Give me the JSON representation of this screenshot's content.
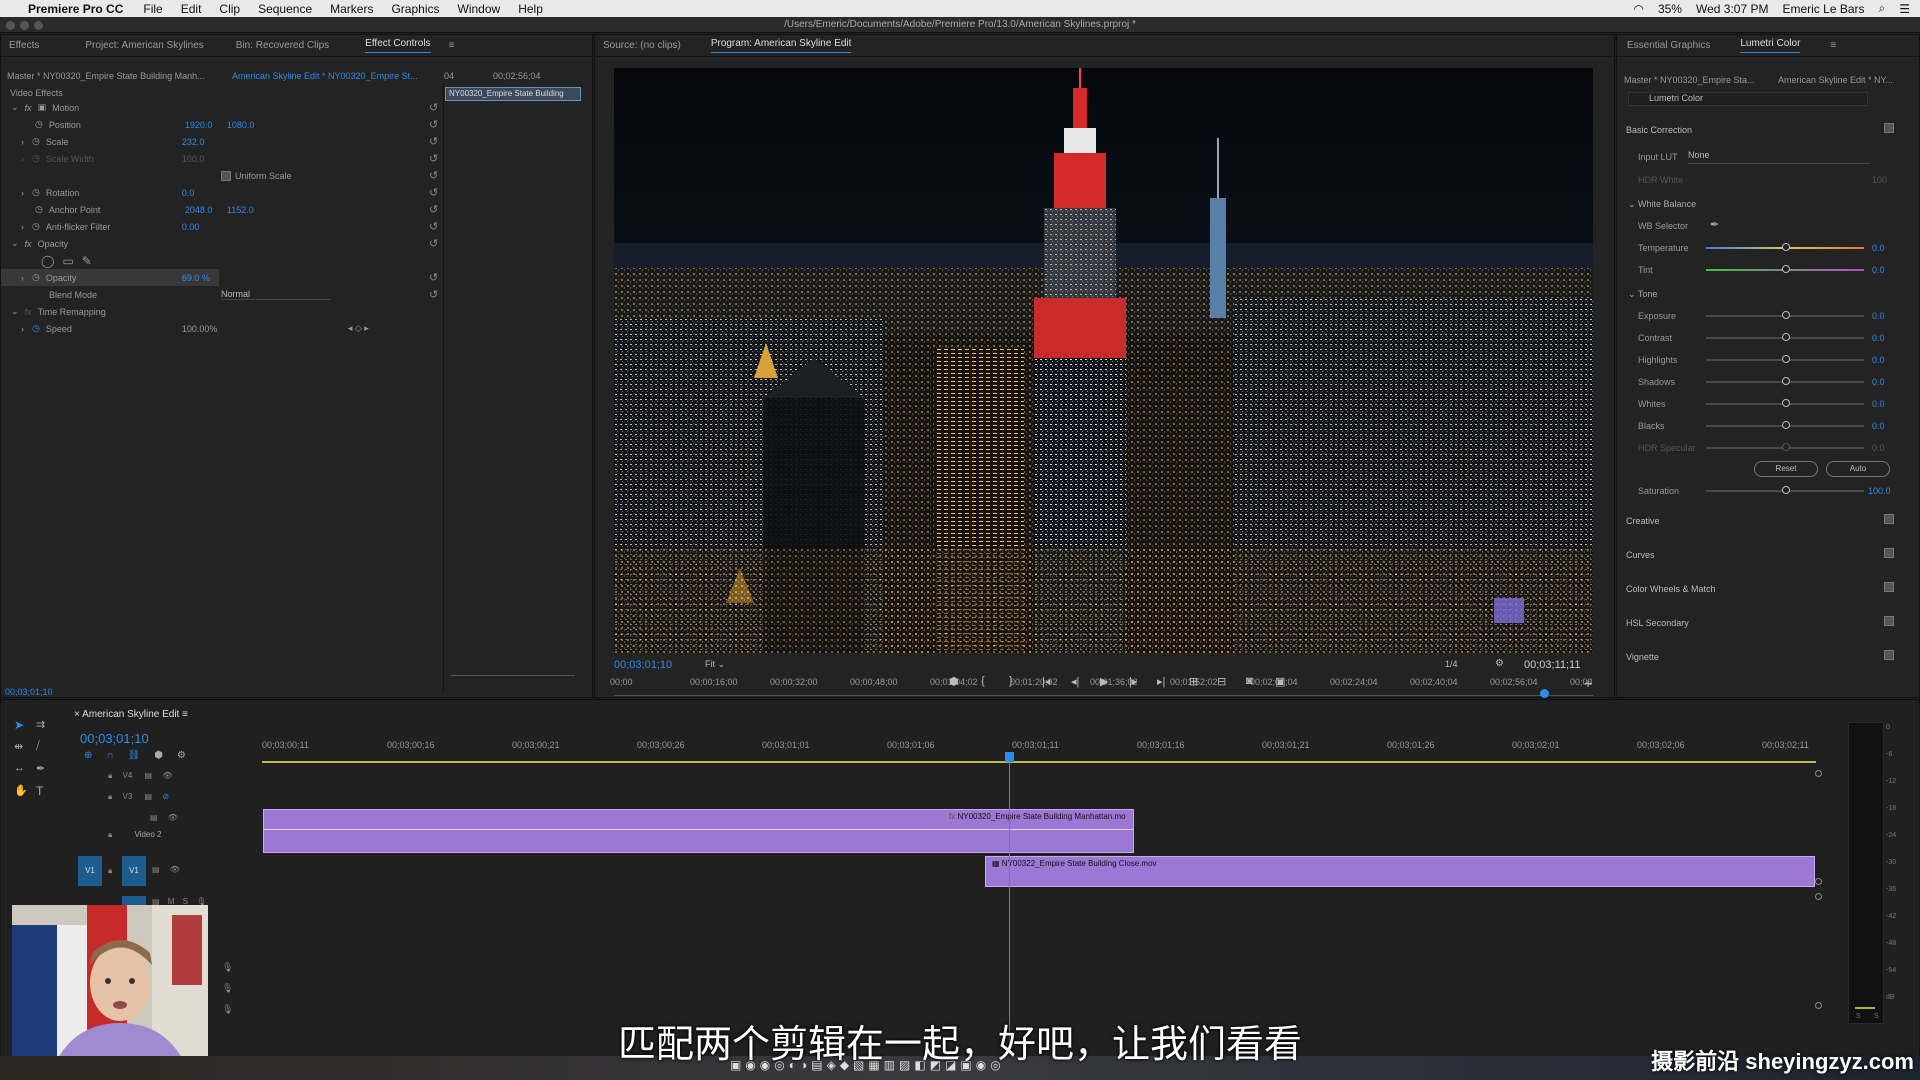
{
  "menubar": {
    "app_name": "Premiere Pro CC",
    "items": [
      "File",
      "Edit",
      "Clip",
      "Sequence",
      "Markers",
      "Graphics",
      "Window",
      "Help"
    ],
    "battery": "35%",
    "clock": "Wed 3:07 PM",
    "user": "Emeric Le Bars"
  },
  "titlebar": {
    "path": "/Users/Emeric/Documents/Adobe/Premiere Pro/13.0/American Skylines.prproj *"
  },
  "left_panel": {
    "tabs": [
      "Effects",
      "Project: American Skylines",
      "Bin: Recovered Clips",
      "Effect Controls"
    ],
    "master_label": "Master * NY00320_Empire State Building Manh...",
    "sequence_label": "American Skyline Edit * NY00320_Empire St...",
    "ruler_start": "04",
    "ruler_time": "00;02;56;04",
    "clip_bar_label": "NY00320_Empire State Building",
    "section_video_effects": "Video Effects",
    "motion": "Motion",
    "position_label": "Position",
    "position_x": "1920.0",
    "position_y": "1080.0",
    "scale_label": "Scale",
    "scale_value": "232.0",
    "scale_width_label": "Scale Width",
    "scale_width_value": "100.0",
    "uniform_scale": "Uniform Scale",
    "rotation_label": "Rotation",
    "rotation_value": "0.0",
    "anchor_label": "Anchor Point",
    "anchor_x": "2048.0",
    "anchor_y": "1152.0",
    "antiflicker_label": "Anti-flicker Filter",
    "antiflicker_value": "0.00",
    "opacity_section": "Opacity",
    "opacity_label": "Opacity",
    "opacity_value": "69.0 %",
    "blend_label": "Blend Mode",
    "blend_value": "Normal",
    "time_remap": "Time Remapping",
    "speed_label": "Speed",
    "speed_value": "100.00%",
    "timecode": "00;03;01;10"
  },
  "program_monitor": {
    "tabs": [
      "Source: (no clips)",
      "Program: American Skyline Edit"
    ],
    "timecode": "00;03;01;10",
    "fit": "Fit",
    "resolution": "1/4",
    "duration": "00;03;11;11",
    "ruler": [
      "00;00",
      "00;00;16;00",
      "00;00;32;00",
      "00;00;48;00",
      "00;01;04;02",
      "00;01;20;02",
      "00;01;36;02",
      "00;01;52;02",
      "00;02;08;04",
      "00;02;24;04",
      "00;02;40;04",
      "00;02;56;04",
      "00;03"
    ],
    "playhead_fraction": 0.95
  },
  "lumetri": {
    "tabs": [
      "Essential Graphics",
      "Lumetri Color"
    ],
    "master_label": "Master * NY00320_Empire Sta...",
    "sequence_label": "American Skyline Edit * NY...",
    "effect_name": "Lumetri Color",
    "basic_correction": "Basic Correction",
    "input_lut_label": "Input LUT",
    "input_lut_value": "None",
    "hdr_white_label": "HDR White",
    "hdr_white_value": "100",
    "white_balance": "White Balance",
    "wb_selector": "WB Selector",
    "temperature": {
      "label": "Temperature",
      "value": "0.0"
    },
    "tint": {
      "label": "Tint",
      "value": "0.0"
    },
    "tone": "Tone",
    "tone_sliders": [
      {
        "label": "Exposure",
        "value": "0.0"
      },
      {
        "label": "Contrast",
        "value": "0.0"
      },
      {
        "label": "Highlights",
        "value": "0.0"
      },
      {
        "label": "Shadows",
        "value": "0.0"
      },
      {
        "label": "Whites",
        "value": "0.0"
      },
      {
        "label": "Blacks",
        "value": "0.0"
      },
      {
        "label": "HDR Specular",
        "value": "0.0"
      }
    ],
    "reset": "Reset",
    "auto": "Auto",
    "saturation": {
      "label": "Saturation",
      "value": "100.0"
    },
    "sections": [
      "Creative",
      "Curves",
      "Color Wheels & Match",
      "HSL Secondary",
      "Vignette"
    ]
  },
  "timeline": {
    "sequence_name": "American Skyline Edit",
    "timecode": "00;03;01;10",
    "ruler": [
      "00;03;00;11",
      "00;03;00;16",
      "00;03;00;21",
      "00;03;00;26",
      "00;03;01;01",
      "00;03;01;06",
      "00;03;01;11",
      "00;03;01;16",
      "00;03;01;21",
      "00;03;01;26",
      "00;03;02;01",
      "00;03;02;06",
      "00;03;02;11"
    ],
    "tracks": [
      "V4",
      "V3",
      "V2",
      "V1"
    ],
    "video2_label": "Video 2",
    "clip_v2": "NY00320_Empire State Building Manhattan.mo",
    "clip_v1": "NY00322_Empire State Building Close.mov",
    "audio_letters": [
      "M",
      "S"
    ]
  },
  "vu_meter": [
    "0",
    "-6",
    "-12",
    "-18",
    "-24",
    "-30",
    "-36",
    "-42",
    "-48",
    "-54",
    "dB"
  ],
  "vu_bottom": [
    "S",
    "S"
  ],
  "subtitle": "匹配两个剪辑在一起，好吧，让我们看看",
  "watermark": "摄影前沿 sheyingzyz.com",
  "colors": {
    "accent": "#2d8ceb",
    "clip": "#9b78d6",
    "empire_red": "#d42a2a"
  }
}
